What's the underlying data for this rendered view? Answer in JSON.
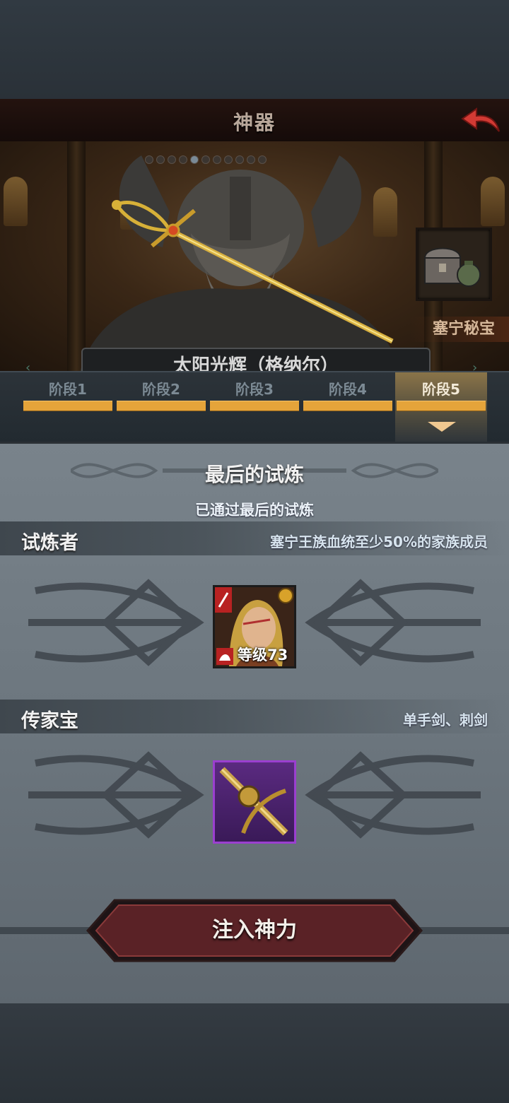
{
  "header": {
    "title": "神器"
  },
  "hero": {
    "chest_label": "塞宁秘宝",
    "artifact_name": "太阳光辉（格纳尔）"
  },
  "stages": [
    "阶段1",
    "阶段2",
    "阶段3",
    "阶段4",
    "阶段5"
  ],
  "stage_progress": [
    1,
    1,
    1,
    1,
    1
  ],
  "active_stage": 5,
  "trial": {
    "title": "最后的试炼",
    "status": "已通过最后的试炼"
  },
  "challenger": {
    "header": "试炼者",
    "requirement": "塞宁王族血统至少50%的家族成员",
    "level_text": "等级73"
  },
  "heirloom": {
    "header": "传家宝",
    "requirement": "单手剑、刺剑"
  },
  "action": {
    "label": "注入神力"
  },
  "colors": {
    "progress": "#e5a43a",
    "panel": "#6c767e",
    "title_bar": "#1c0f0c",
    "accent_red": "#c0282a",
    "rare_purple": "#9b3fd0"
  }
}
